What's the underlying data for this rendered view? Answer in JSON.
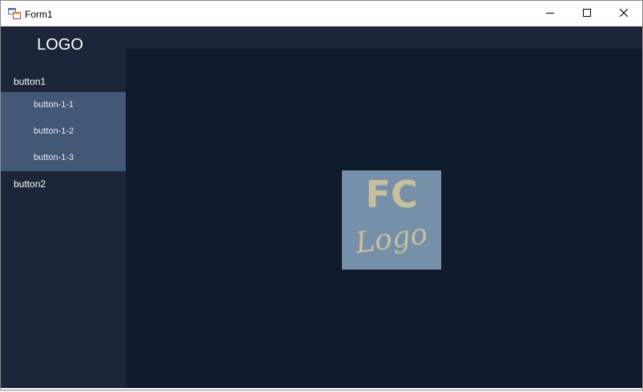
{
  "window": {
    "title": "Form1",
    "icon": "winforms-app-icon",
    "controls": {
      "minimize_icon": "minimize-icon",
      "maximize_icon": "maximize-icon",
      "close_icon": "close-icon"
    }
  },
  "sidebar": {
    "logo_text": "LOGO",
    "button1_label": "button1",
    "submenu": [
      {
        "label": "button-1-1"
      },
      {
        "label": "button-1-2"
      },
      {
        "label": "button-1-3"
      }
    ],
    "button2_label": "button2"
  },
  "main": {
    "logo_fc": "FC",
    "logo_script": "Logo"
  },
  "colors": {
    "sidebar_bg": "#1c2539",
    "submenu_bg": "#435877",
    "main_bg": "#0f1b2c",
    "logo_box_bg": "#7590a8",
    "logo_text": "#c9bf9f"
  }
}
